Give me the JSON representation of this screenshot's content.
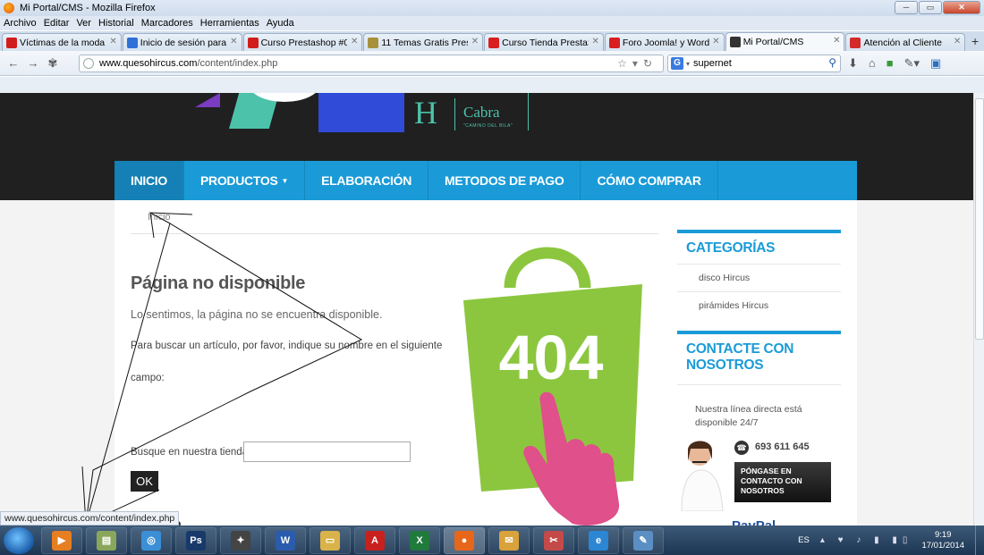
{
  "window": {
    "title": "Mi Portal/CMS - Mozilla Firefox"
  },
  "menu": [
    "Archivo",
    "Editar",
    "Ver",
    "Historial",
    "Marcadores",
    "Herramientas",
    "Ayuda"
  ],
  "tabs": [
    {
      "label": "Víctimas de la moda [...",
      "icon": "youtube-icon",
      "color": "#d21d1d"
    },
    {
      "label": "Inicio de sesión para ...",
      "icon": "blogger-b-icon",
      "color": "#2f6fd8"
    },
    {
      "label": "Curso Prestashop #05...",
      "icon": "youtube-icon",
      "color": "#d21d1d"
    },
    {
      "label": "11 Temas Gratis Prest...",
      "icon": "search-icon",
      "color": "#a7923a"
    },
    {
      "label": "Curso Tienda PrestaS...",
      "icon": "w-icon",
      "color": "#d81e1e"
    },
    {
      "label": "Foro Joomla! y Word...",
      "icon": "w-icon",
      "color": "#d81e1e"
    },
    {
      "label": "Mi Portal/CMS",
      "icon": "joomla-icon",
      "color": "#333333",
      "active": true
    },
    {
      "label": "Atención al Cliente",
      "icon": "shop-icon",
      "color": "#d32a2a"
    }
  ],
  "nav": {
    "url_domain": "www.quesohircus.com",
    "url_path": "/content/index.php",
    "search_value": "supernet",
    "search_engine": "G"
  },
  "site": {
    "logo_brand": "Cabra",
    "logo_letter": "H",
    "logo_tagline": "\"CAMINO DEL BILA\"",
    "menu": [
      {
        "label": "INICIO",
        "active": true
      },
      {
        "label": "PRODUCTOS",
        "dropdown": true
      },
      {
        "label": "ELABORACIÓN"
      },
      {
        "label": "METODOS DE PAGO"
      },
      {
        "label": "CÓMO COMPRAR"
      }
    ],
    "breadcrumb": "Inicio",
    "error": {
      "title": "Página no disponible",
      "subtitle": "Lo sentimos, la página no se encuentra disponible.",
      "text1": "Para buscar un artículo, por favor, indique su nombre en el siguiente",
      "text2": "campo:",
      "search_label": "Busque en nuestra tienda:",
      "search_value": "",
      "ok_label": "OK",
      "cut_text": "icio",
      "badge_404": "404"
    },
    "sidebar": {
      "categories_title": "CATEGORÍAS",
      "categories": [
        "disco Hircus",
        "pirámides Hircus"
      ],
      "contact_title": "CONTACTE CON NOSOTROS",
      "contact_text": "Nuestra línea directa está disponible 24/7",
      "phone": "693 611 645",
      "contact_button": "PÓNGASE EN CONTACTO CON NOSOTROS",
      "partial_logo": "PayPal"
    }
  },
  "status_link": "www.quesohircus.com/content/index.php",
  "taskbar": {
    "apps": [
      {
        "name": "media-player",
        "color": "#e67e22",
        "glyph": "▶"
      },
      {
        "name": "documents",
        "color": "#8aa65a",
        "glyph": "▤"
      },
      {
        "name": "browser-globe",
        "color": "#3b8fd6",
        "glyph": "◎"
      },
      {
        "name": "photoshop",
        "color": "#173a6a",
        "glyph": "Ps"
      },
      {
        "name": "audio-app",
        "color": "#444444",
        "glyph": "✦"
      },
      {
        "name": "word",
        "color": "#2a5cad",
        "glyph": "W"
      },
      {
        "name": "file-explorer",
        "color": "#d9b24a",
        "glyph": "▭"
      },
      {
        "name": "acrobat",
        "color": "#c8211d",
        "glyph": "A"
      },
      {
        "name": "excel",
        "color": "#1f7a3c",
        "glyph": "X"
      },
      {
        "name": "firefox",
        "color": "#e8661a",
        "glyph": "●",
        "active": true
      },
      {
        "name": "outlook",
        "color": "#d9a23a",
        "glyph": "✉"
      },
      {
        "name": "snipping-tool",
        "color": "#c44a4a",
        "glyph": "✂"
      },
      {
        "name": "internet-explorer",
        "color": "#2d86d4",
        "glyph": "e"
      },
      {
        "name": "notepad",
        "color": "#5b8fc4",
        "glyph": "✎"
      }
    ],
    "language": "ES",
    "time": "9:19",
    "date": "17/01/2014"
  },
  "colors": {
    "nav_blue": "#1a9bd7",
    "bag_green": "#8cc63f",
    "hand_pink": "#e0508a"
  }
}
